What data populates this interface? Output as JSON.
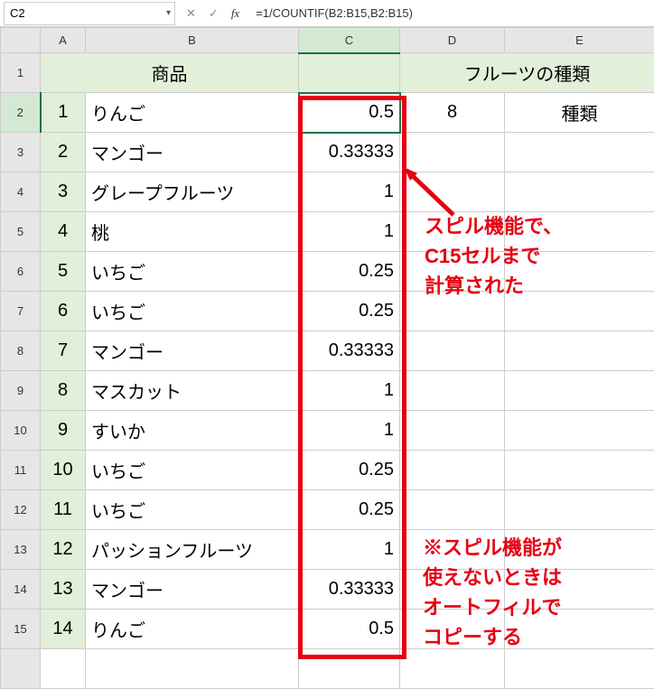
{
  "nameBox": "C2",
  "formulaBar": "=1/COUNTIF(B2:B15,B2:B15)",
  "columns": {
    "corner": "",
    "A": "A",
    "B": "B",
    "C": "C",
    "D": "D",
    "E": "E"
  },
  "headerRow": {
    "no": "1",
    "B": "商品",
    "C": "",
    "DE": "フルーツの種類"
  },
  "resultRow": {
    "D": "8",
    "E": "種類"
  },
  "rows": [
    {
      "no": "2",
      "a": "1",
      "b": "りんご",
      "c": "0.5"
    },
    {
      "no": "3",
      "a": "2",
      "b": "マンゴー",
      "c": "0.33333"
    },
    {
      "no": "4",
      "a": "3",
      "b": "グレープフルーツ",
      "c": "1"
    },
    {
      "no": "5",
      "a": "4",
      "b": "桃",
      "c": "1"
    },
    {
      "no": "6",
      "a": "5",
      "b": "いちご",
      "c": "0.25"
    },
    {
      "no": "7",
      "a": "6",
      "b": "いちご",
      "c": "0.25"
    },
    {
      "no": "8",
      "a": "7",
      "b": "マンゴー",
      "c": "0.33333"
    },
    {
      "no": "9",
      "a": "8",
      "b": "マスカット",
      "c": "1"
    },
    {
      "no": "10",
      "a": "9",
      "b": "すいか",
      "c": "1"
    },
    {
      "no": "11",
      "a": "10",
      "b": "いちご",
      "c": "0.25"
    },
    {
      "no": "12",
      "a": "11",
      "b": "いちご",
      "c": "0.25"
    },
    {
      "no": "13",
      "a": "12",
      "b": "パッションフルーツ",
      "c": "1"
    },
    {
      "no": "14",
      "a": "13",
      "b": "マンゴー",
      "c": "0.33333"
    },
    {
      "no": "15",
      "a": "14",
      "b": "りんご",
      "c": "0.5"
    }
  ],
  "extraRowNo": "",
  "annotations": {
    "a1l1": "スピル機能で、",
    "a1l2": "C15セルまで",
    "a1l3": "計算された",
    "a2l1": "※スピル機能が",
    "a2l2": "使えないときは",
    "a2l3": "オートフィルで",
    "a2l4": "コピーする"
  },
  "icons": {
    "cancel": "✕",
    "confirm": "✓",
    "fx": "fx",
    "dropdown": "▾"
  }
}
